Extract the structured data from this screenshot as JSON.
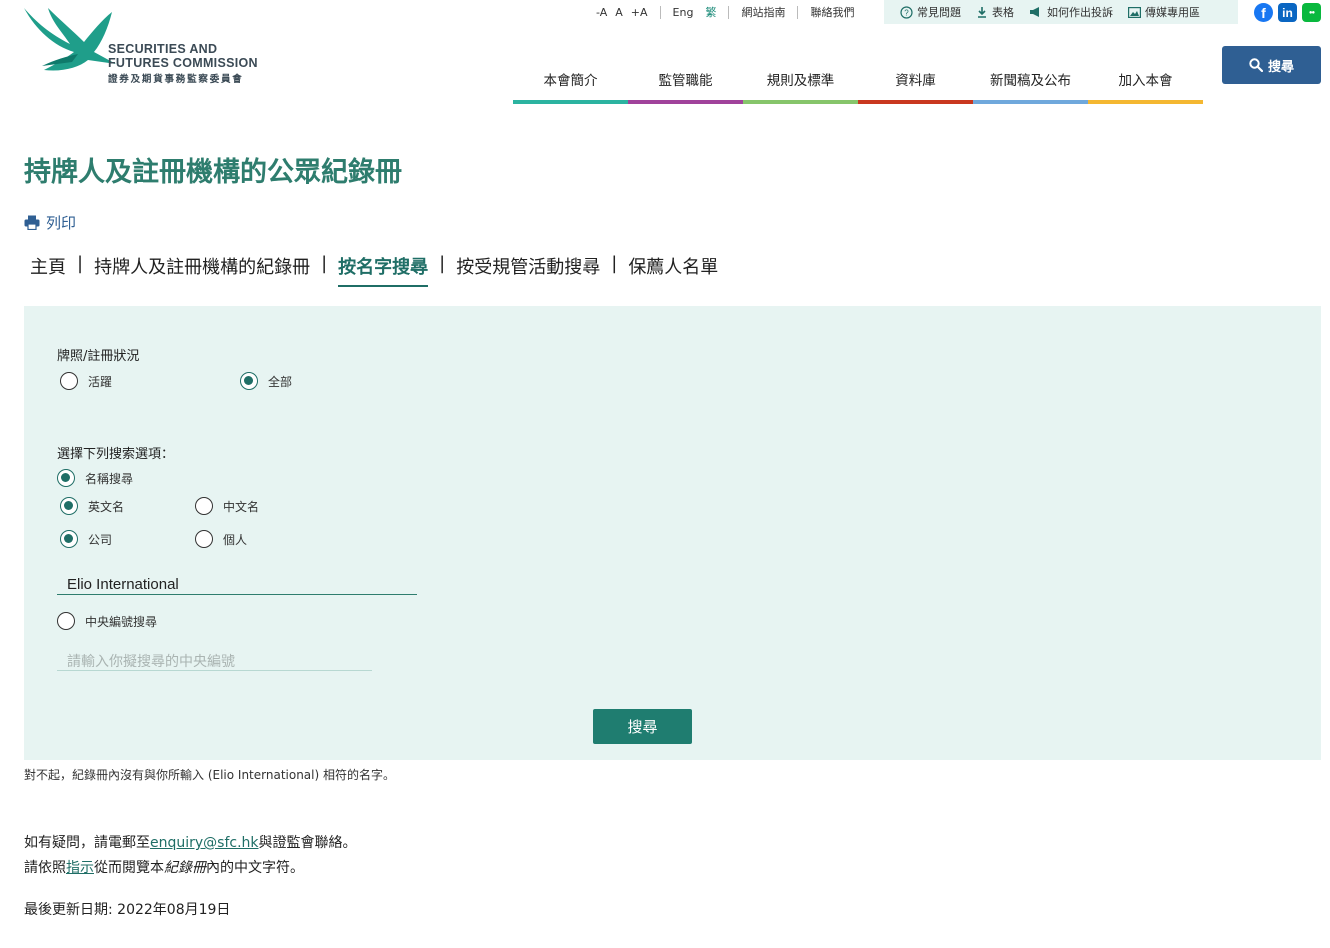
{
  "header": {
    "logo": {
      "name_en_line1": "SECURITIES AND",
      "name_en_line2": "FUTURES COMMISSION",
      "name_zh": "證券及期貨事務監察委員會"
    },
    "font_size_controls": [
      "-A",
      "A",
      "+A"
    ],
    "lang_en": "Eng",
    "lang_zh": "繁",
    "sitemap": "網站指南",
    "contact": "聯絡我們",
    "util_links": [
      {
        "label": "常見問題",
        "icon": "question-circle-icon"
      },
      {
        "label": "表格",
        "icon": "download-icon"
      },
      {
        "label": "如何作出投訴",
        "icon": "megaphone-icon"
      },
      {
        "label": "傳媒專用區",
        "icon": "image-icon"
      }
    ],
    "social": [
      {
        "name": "facebook-icon",
        "glyph": "f",
        "color": "#1877f2"
      },
      {
        "name": "linkedin-icon",
        "glyph": "in",
        "color": "#0a66c2"
      },
      {
        "name": "wechat-icon",
        "glyph": "●●",
        "color": "#09b83e"
      }
    ],
    "nav": [
      {
        "label": "本會簡介",
        "color": "#2bb3a0"
      },
      {
        "label": "監管職能",
        "color": "#a0429b"
      },
      {
        "label": "規則及標準",
        "color": "#86c56b"
      },
      {
        "label": "資料庫",
        "color": "#c9381f"
      },
      {
        "label": "新聞稿及公布",
        "color": "#6fa8dc"
      },
      {
        "label": "加入本會",
        "color": "#f4b731"
      }
    ],
    "search_label": "搜尋"
  },
  "page": {
    "title": "持牌人及註冊機構的公眾紀錄冊",
    "print_label": "列印",
    "breadcrumbs": [
      {
        "label": "主頁",
        "active": false
      },
      {
        "label": "持牌人及註冊機構的紀錄冊",
        "active": false
      },
      {
        "label": "按名字搜尋",
        "active": true
      },
      {
        "label": "按受規管活動搜尋",
        "active": false
      },
      {
        "label": "保薦人名單",
        "active": false
      }
    ],
    "crumb_separator": "|"
  },
  "form": {
    "status_label": "牌照/註冊狀況",
    "status_active": "活躍",
    "status_all": "全部",
    "status_selected": "全部",
    "options_label": "選擇下列搜索選項：",
    "name_search": "名稱搜尋",
    "english_name": "英文名",
    "chinese_name": "中文名",
    "company": "公司",
    "individual": "個人",
    "name_value": "Elio International",
    "ce_search": "中央編號搜尋",
    "ce_placeholder": "請輸入你擬搜尋的中央編號",
    "submit_label": "搜尋"
  },
  "result_message": "對不起，紀錄冊內沒有與你所輸入 (Elio International) 相符的名字。",
  "footer": {
    "enquiry_prefix": "如有疑問，請電郵至",
    "enquiry_email": "enquiry@sfc.hk",
    "enquiry_suffix": "與證監會聯絡。",
    "guide_prefix": "請依照",
    "guide_link": "指示",
    "guide_middle": "從而閱覽本",
    "guide_italic": "紀錄冊",
    "guide_suffix": "內的中文字符。",
    "last_updated": "最後更新日期: 2022年08月19日"
  }
}
